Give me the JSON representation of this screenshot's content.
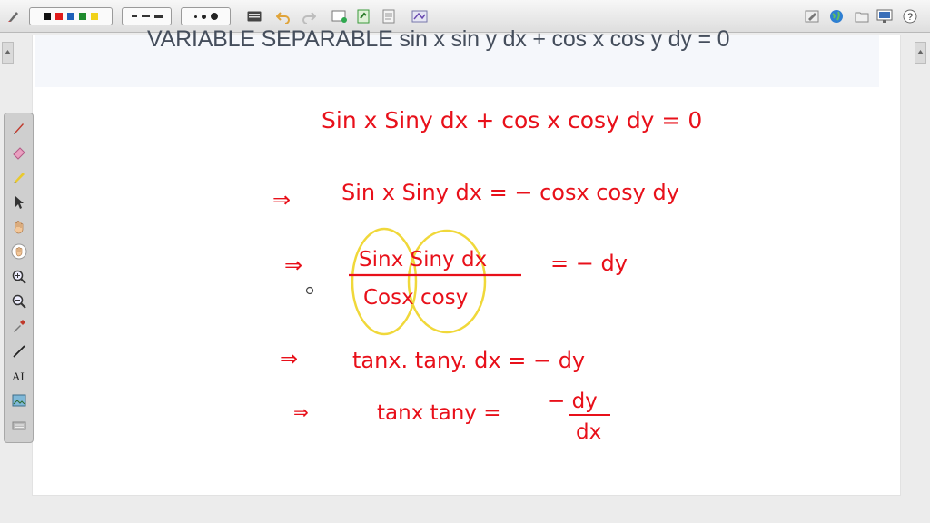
{
  "toolbar": {
    "left_icons": [
      "pen-settings-icon"
    ],
    "color_swatches": [
      "#111111",
      "#e01b1b",
      "#1d5fb8",
      "#1e8a2d",
      "#f1d21a"
    ],
    "line_styles": [
      "dash-short",
      "dash-medium",
      "solid-thick"
    ],
    "dot_sizes": [
      "small",
      "medium",
      "large"
    ],
    "actions": [
      "keyboard-icon",
      "undo-icon",
      "redo-icon",
      "new-page-icon",
      "export-icon",
      "document-icon",
      "settings-icon"
    ],
    "right_icons": [
      "edit-icon",
      "globe-icon",
      "folder-icon",
      "display-icon",
      "help-icon"
    ]
  },
  "page": {
    "title": "VARIABLE SEPARABLE sin x sin y dx + cos x cos y dy = 0"
  },
  "left_tools": [
    "pen-icon",
    "eraser-icon",
    "highlighter-icon",
    "pointer-icon",
    "hand-icon",
    "palm-icon",
    "zoom-in-icon",
    "zoom-out-icon",
    "eyedropper-icon",
    "line-icon",
    "text-icon",
    "image-icon",
    "keyboard-tray-icon"
  ],
  "handwriting": {
    "line1": "Sin x Siny dx + cos x cosy dy = 0",
    "line2_arrow": "⇒",
    "line2": "Sin x Siny dx = − cosx cosy  dy",
    "line3_arrow": "⇒",
    "line3_num": "Sinx Siny dx",
    "line3_den": "Cosx cosy",
    "line3_rhs": "= − dy",
    "line4_arrow": "⇒",
    "line4": "tanx. tany. dx = − dy",
    "line5_arrow": "⇒",
    "line5_lhs": "tanx tany =",
    "line5_num": "− dy",
    "line5_den": "dx"
  },
  "colors": {
    "ink_red": "#e8101a",
    "ink_yellow": "#f0d83a",
    "title_text": "#454e5c"
  }
}
